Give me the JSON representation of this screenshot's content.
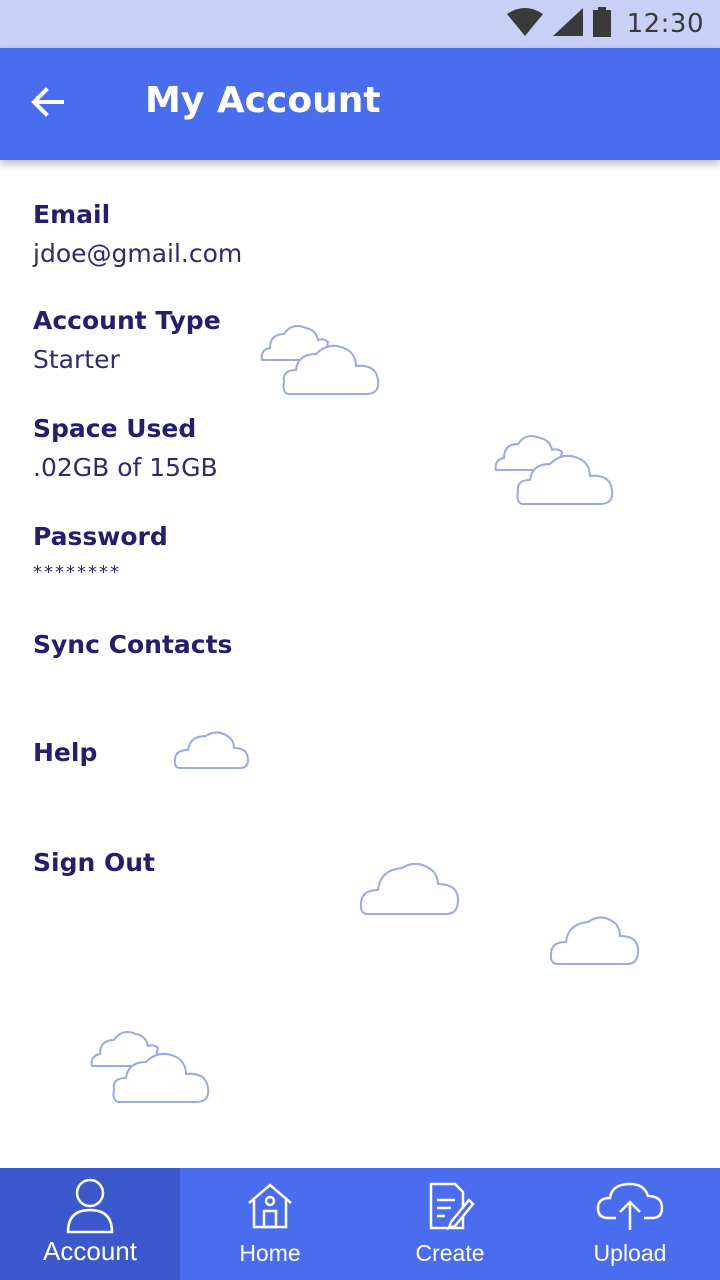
{
  "status_bar": {
    "time": "12:30",
    "icons": [
      "wifi-icon",
      "signal-icon",
      "battery-icon"
    ]
  },
  "app_bar": {
    "back_icon": "arrow-left-icon",
    "title": "My Account"
  },
  "account": {
    "email_label": "Email",
    "email_value": "jdoe@gmail.com",
    "type_label": "Account Type",
    "type_value": "Starter",
    "space_label": "Space Used",
    "space_value": ".02GB of 15GB",
    "password_label": "Password",
    "password_value": "********"
  },
  "menu": {
    "sync_contacts": "Sync Contacts",
    "help": "Help",
    "sign_out": "Sign Out"
  },
  "bottom_nav": {
    "items": [
      {
        "label": "Account",
        "icon": "person-icon",
        "active": true
      },
      {
        "label": "Home",
        "icon": "home-icon",
        "active": false
      },
      {
        "label": "Create",
        "icon": "edit-document-icon",
        "active": false
      },
      {
        "label": "Upload",
        "icon": "cloud-upload-icon",
        "active": false
      }
    ]
  },
  "colors": {
    "primary": "#4a6cee",
    "primary_dark": "#3b58cc",
    "status_bar": "#c9d0f5",
    "text_dark": "#231e6e",
    "cloud_outline": "#9aa8ee"
  }
}
